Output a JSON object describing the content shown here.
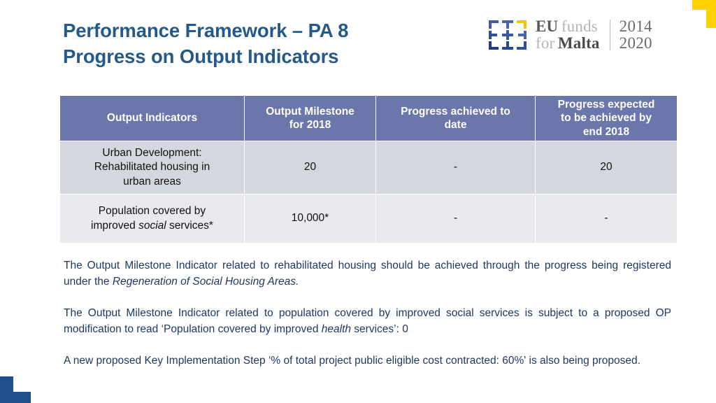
{
  "slide": {
    "title_line_1": "Performance Framework – PA 8",
    "title_line_2": "Progress on Output Indicators"
  },
  "logo": {
    "mark_name": "eu-funds-for-malta-logo",
    "eu": "EU",
    "funds": "funds",
    "for": "for",
    "malta": "Malta",
    "year_from": "2014",
    "year_to": "2020"
  },
  "decor": {
    "top_right_color": "#FFD100",
    "bottom_left_color": "#1F4E8C"
  },
  "colors": {
    "title": "#255A88",
    "table_header_bg": "#6B76AB",
    "row_a_bg": "#D4D7DE",
    "row_b_bg": "#E9E9EE",
    "body_text": "#1F3864"
  },
  "table": {
    "headers": [
      "Output Indicators",
      "Output Milestone for 2018",
      "Progress achieved to date",
      "Progress expected to be achieved by end 2018"
    ],
    "header_lines": {
      "col1": [
        "Output Indicators"
      ],
      "col2": [
        "Output Milestone",
        "for 2018"
      ],
      "col3": [
        "Progress achieved to",
        "date"
      ],
      "col4": [
        "Progress expected",
        "to be achieved by",
        "end 2018"
      ]
    },
    "rows": [
      {
        "indicator_lines": [
          "Urban Development:",
          "Rehabilitated housing in",
          "urban areas"
        ],
        "indicator": "Urban Development: Rehabilitated housing in urban areas",
        "milestone_2018": "20",
        "progress_to_date": "-",
        "progress_expected_end_2018": "20"
      },
      {
        "indicator_lines": [
          "Population covered by",
          "improved social services*"
        ],
        "indicator_prefix": "Population covered by improved ",
        "indicator_italic": "social",
        "indicator_suffix": " services*",
        "indicator": "Population covered by improved social services*",
        "milestone_2018": "10,000*",
        "progress_to_date": "-",
        "progress_expected_end_2018": "-"
      }
    ]
  },
  "notes": [
    {
      "id": "note-rehabilitated-housing",
      "prefix": "The Output Milestone Indicator related to rehabilitated housing should be achieved through the progress being registered under the ",
      "italic": "Regeneration of Social Housing Areas.",
      "suffix": ""
    },
    {
      "id": "note-social-services",
      "prefix": "The Output Milestone Indicator related to population covered by improved social services is subject to a proposed OP modification to read ‘Population covered by improved ",
      "italic": "health",
      "suffix": " services’:  0"
    },
    {
      "id": "note-key-implementation-step",
      "prefix": "A new proposed Key Implementation Step ‘% of total project public eligible cost contracted: 60%' is also being proposed.",
      "italic": "",
      "suffix": ""
    }
  ]
}
